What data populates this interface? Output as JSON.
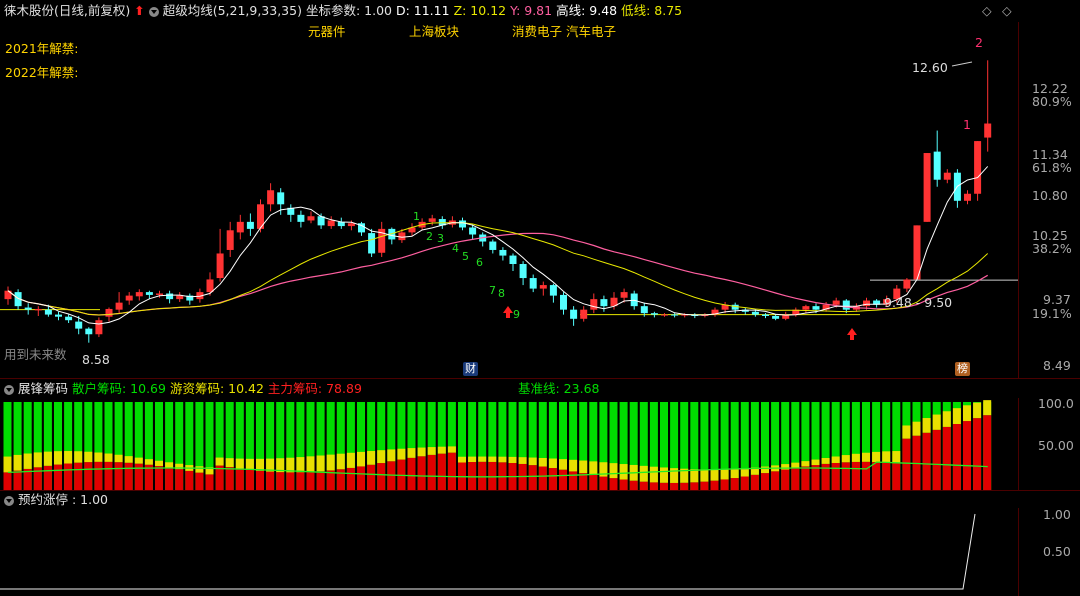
{
  "header": {
    "stock_name": "徕木股份",
    "period": "(日线,前复权)",
    "indicator_name": "超级均线(5,21,9,33,35)",
    "params_label": "坐标参数: 1.00",
    "d_label": "D: 11.11",
    "z_label": "Z: 10.12",
    "y_label": "Y: 9.81",
    "high_label": "高线: 9.48",
    "low_label": "低线: 8.75"
  },
  "concepts": [
    "元器件",
    "上海板块",
    "消费电子 汽车电子"
  ],
  "unlock_notes": [
    "2021年解禁:",
    "2022年解禁:"
  ],
  "annotations": {
    "peak_price": "12.60",
    "peak_marker": "2",
    "peak_marker2": "1",
    "range_label": "9.48 - 9.50",
    "low_price": "8.58",
    "future_text": "用到未来数",
    "fin_badge": "财",
    "rank_badge": "榜",
    "sequence": [
      "1",
      "2",
      "3",
      "4",
      "5",
      "6",
      "7",
      "8",
      "9"
    ]
  },
  "price_axis": [
    "12.22",
    "80.9%",
    "11.34",
    "61.8%",
    "10.80",
    "10.25",
    "38.2%",
    "9.37",
    "19.1%",
    "8.49"
  ],
  "chip_panel": {
    "title": "展锋筹码",
    "retail_label": "散户筹码: 10.69",
    "hot_label": "游资筹码: 10.42",
    "main_label": "主力筹码: 78.89",
    "base_label": "基准线: 23.68",
    "axis": [
      "100.0",
      "50.00"
    ]
  },
  "limit_panel": {
    "title": "预约涨停",
    "value_label": ": 1.00",
    "axis": [
      "1.00",
      "0.50"
    ]
  },
  "colors": {
    "up": "#ff3333",
    "down": "#54ffff",
    "ma_white": "#ffffff",
    "ma_yellow": "#e8e800",
    "ma_pink": "#ff5fa0",
    "green": "#00dd00",
    "yellow": "#e8e000",
    "red": "#e00000"
  }
}
